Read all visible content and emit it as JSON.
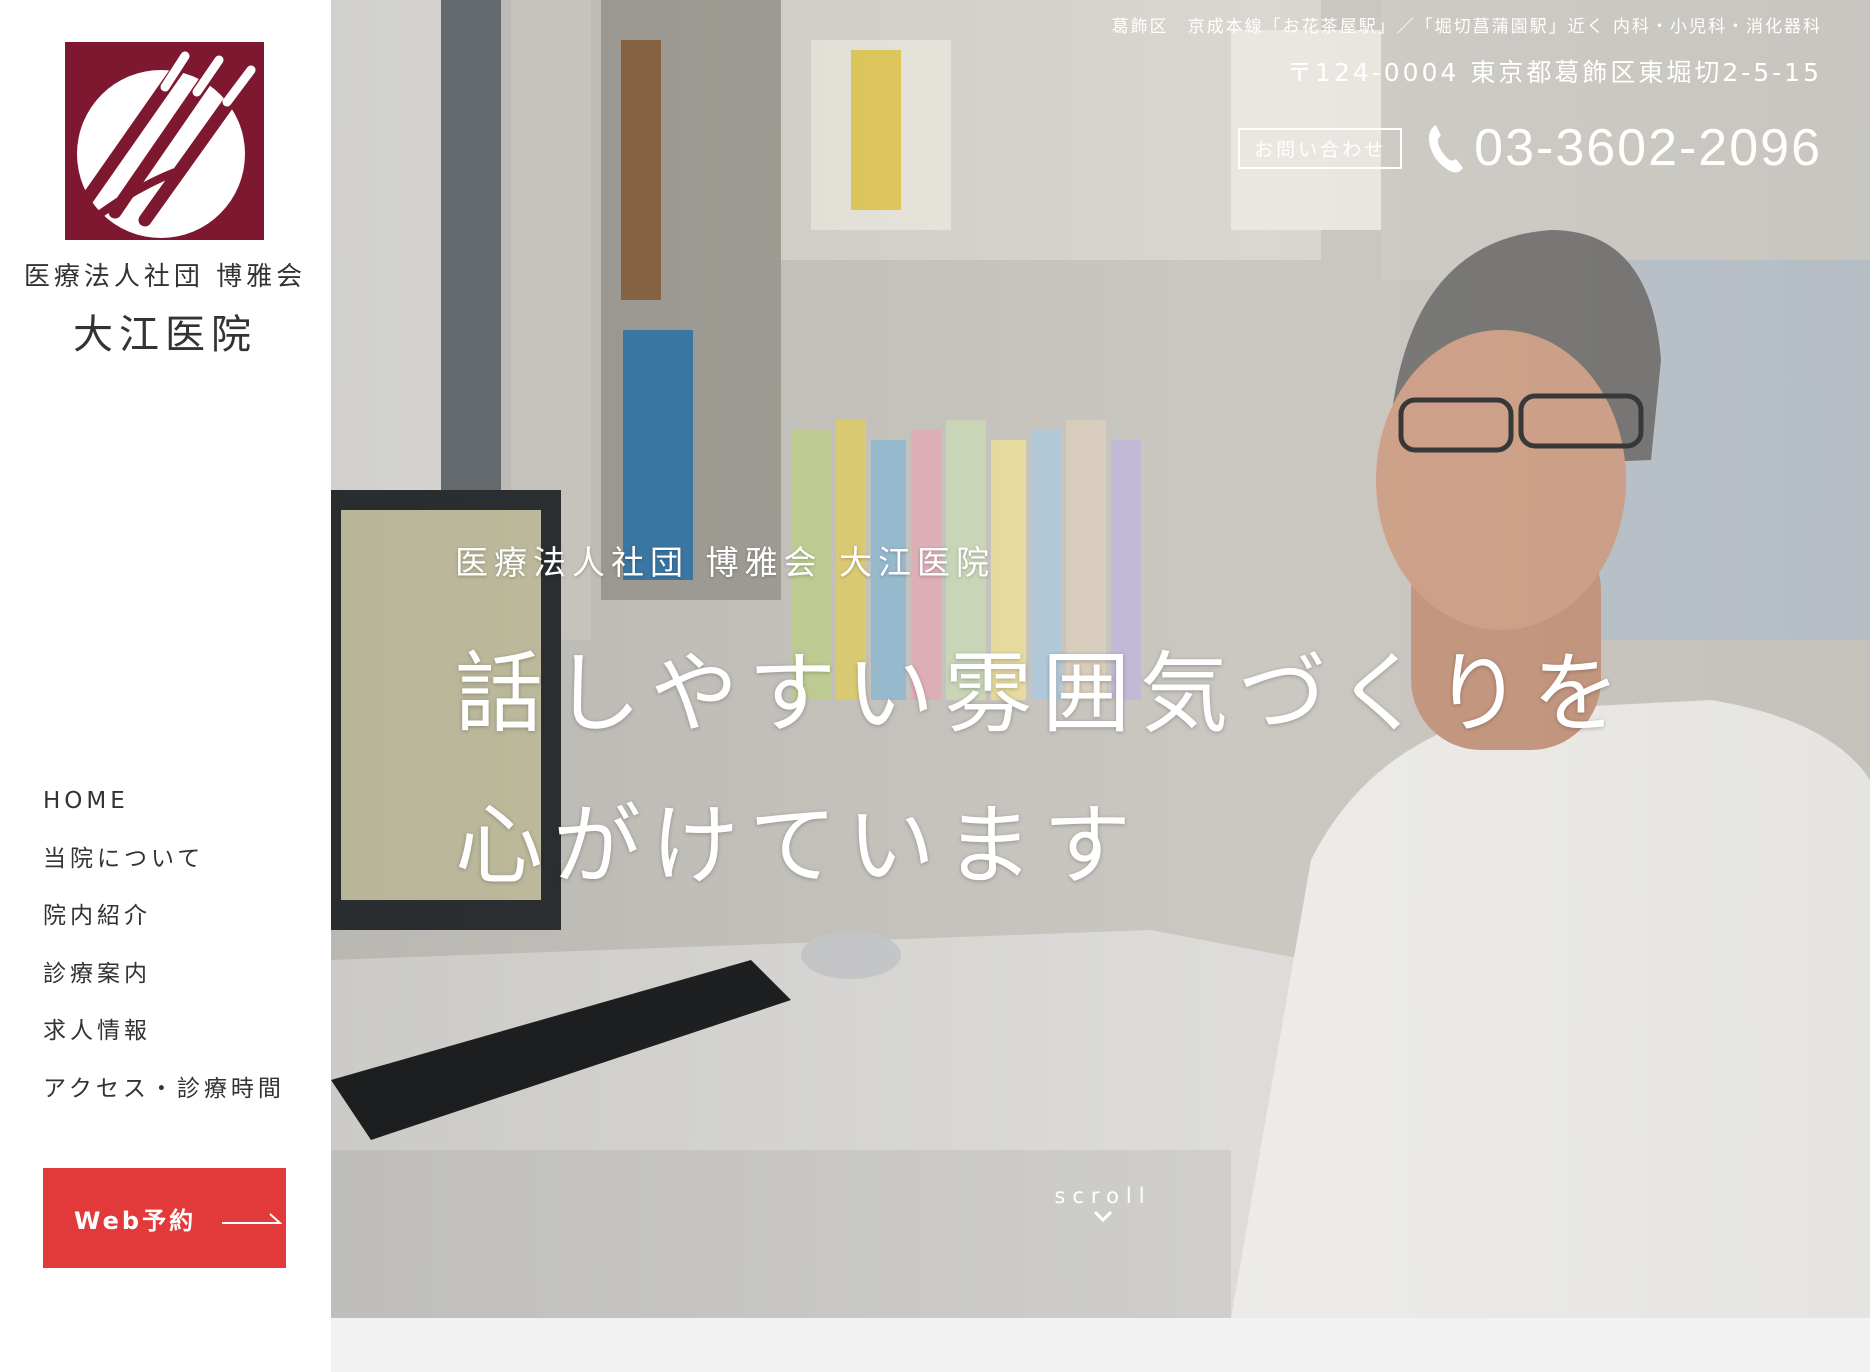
{
  "sidebar": {
    "org_name": "医療法人社団 博雅会",
    "clinic_name": "大江医院",
    "nav": [
      {
        "label": "HOME"
      },
      {
        "label": "当院について"
      },
      {
        "label": "院内紹介"
      },
      {
        "label": "診療案内"
      },
      {
        "label": "求人情報"
      },
      {
        "label": "アクセス・診療時間"
      }
    ],
    "reserve_label": "Web予約"
  },
  "header": {
    "access": "葛飾区　京成本線「お花茶屋駅」／「堀切菖蒲園駅」近く 内科・小児科・消化器科",
    "address": "〒124-0004 東京都葛飾区東堀切2-5-15",
    "contact_label": "お問い合わせ",
    "phone": "03-3602-2096"
  },
  "hero": {
    "subtitle": "医療法人社団 博雅会 大江医院",
    "title_line1": "話しやすい雰囲気づくりを",
    "title_line2": "心がけています",
    "scroll_label": "scroll"
  },
  "colors": {
    "logo": "#7e1830",
    "reserve_button": "#e23a3a"
  },
  "icons": [
    "logo-mark",
    "phone-icon",
    "arrow-right-icon",
    "chevron-down-icon"
  ]
}
